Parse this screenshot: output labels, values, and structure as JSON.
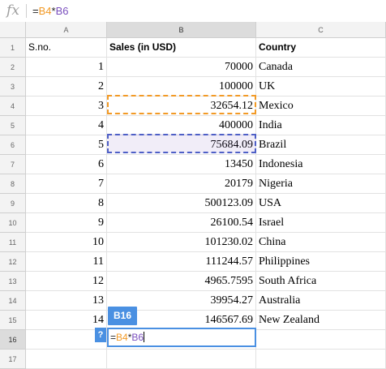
{
  "formula_bar": {
    "icon": "fx-icon",
    "formula": {
      "eq": "=",
      "ref1": "B4",
      "op": "*",
      "ref2": "B6"
    }
  },
  "colors": {
    "ref_b4": "#f29a26",
    "ref_b6": "#7a4fbe",
    "active_tag": "#4a90e2"
  },
  "columns": [
    "A",
    "B",
    "C"
  ],
  "rows": [
    {
      "row": "1",
      "a": "S.no.",
      "b": "Sales (in USD)",
      "c": "Country"
    },
    {
      "row": "2",
      "a": "1",
      "b": "70000",
      "c": "Canada"
    },
    {
      "row": "3",
      "a": "2",
      "b": "100000",
      "c": "UK"
    },
    {
      "row": "4",
      "a": "3",
      "b": "32654.12",
      "c": "Mexico"
    },
    {
      "row": "5",
      "a": "4",
      "b": "400000",
      "c": "India"
    },
    {
      "row": "6",
      "a": "5",
      "b": "75684.09",
      "c": "Brazil"
    },
    {
      "row": "7",
      "a": "6",
      "b": "13450",
      "c": "Indonesia"
    },
    {
      "row": "8",
      "a": "7",
      "b": "20179",
      "c": "Nigeria"
    },
    {
      "row": "9",
      "a": "8",
      "b": "500123.09",
      "c": "USA"
    },
    {
      "row": "10",
      "a": "9",
      "b": "26100.54",
      "c": "Israel"
    },
    {
      "row": "11",
      "a": "10",
      "b": "101230.02",
      "c": "China"
    },
    {
      "row": "12",
      "a": "11",
      "b": "111244.57",
      "c": "Philippines"
    },
    {
      "row": "13",
      "a": "12",
      "b": "4965.7595",
      "c": "South Africa"
    },
    {
      "row": "14",
      "a": "13",
      "b": "39954.27",
      "c": "Australia"
    },
    {
      "row": "15",
      "a": "14",
      "b": "146567.69",
      "c": "New Zealand"
    },
    {
      "row": "16",
      "a": "",
      "b": "",
      "c": ""
    },
    {
      "row": "17",
      "a": "",
      "b": "",
      "c": ""
    }
  ],
  "active_cell": {
    "tag": "B16",
    "help": "?"
  },
  "editor": {
    "eq": "=",
    "ref1": "B4",
    "op": "*",
    "ref2": "B6"
  }
}
